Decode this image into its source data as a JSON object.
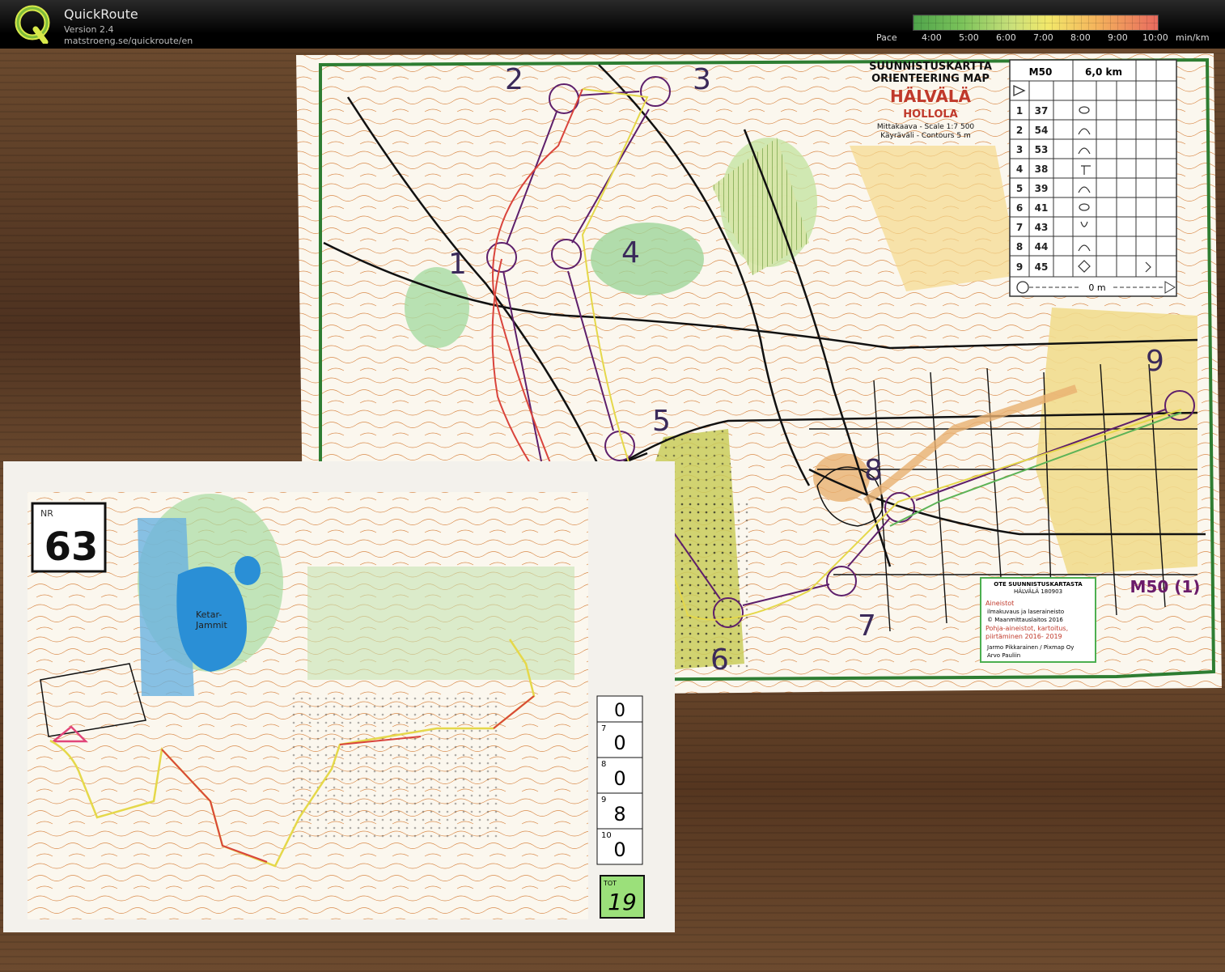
{
  "app": {
    "title": "QuickRoute",
    "version": "Version 2.4",
    "url": "matstroeng.se/quickroute/en",
    "logo_letter": "Q"
  },
  "pace_legend": {
    "label": "Pace",
    "ticks": [
      "4:00",
      "5:00",
      "6:00",
      "7:00",
      "8:00",
      "9:00",
      "10:00"
    ],
    "unit": "min/km"
  },
  "map": {
    "title_line1": "SUUNNISTUSKARTTA",
    "title_line2": "ORIENTEERING MAP",
    "area": "HÄLVÄLÄ",
    "municipality": "HOLLOLA",
    "scale": "Mittakaava - Scale 1:7 500",
    "contours": "Käyräväli - Contours 5 m",
    "course_label": "M50 (1)",
    "credits": {
      "header1": "OTE SUUNNISTUSKARTASTA",
      "header2": "HÄLVÄLÄ 180903",
      "aineistot": "Aineistot",
      "line1": "ilmakuvaus ja laseraineisto",
      "line2": "© Maanmittauslaitos 2016",
      "line3": "Pohja-aineistot, kartoitus,",
      "line4": "piirtäminen 2016- 2019",
      "line5": "Jarmo Pikkarainen / Pixmap Oy",
      "line6": "Arvo Pauliin"
    },
    "control_numbers": [
      "1",
      "2",
      "3",
      "4",
      "5",
      "6",
      "7",
      "8",
      "9"
    ]
  },
  "description_sheet": {
    "course": "M50",
    "length": "6,0 km",
    "rows": [
      {
        "n": "1",
        "code": "37"
      },
      {
        "n": "2",
        "code": "54"
      },
      {
        "n": "3",
        "code": "53"
      },
      {
        "n": "4",
        "code": "38"
      },
      {
        "n": "5",
        "code": "39"
      },
      {
        "n": "6",
        "code": "41"
      },
      {
        "n": "7",
        "code": "43"
      },
      {
        "n": "8",
        "code": "44"
      },
      {
        "n": "9",
        "code": "45"
      }
    ],
    "finish": "0 m"
  },
  "second_map": {
    "nr_label": "NR",
    "nr_value": "63",
    "lake_label_1": "Ketar-",
    "lake_label_2": "Jammit",
    "score_rows": [
      {
        "n": "7",
        "score": "0"
      },
      {
        "n": "8",
        "score": "0"
      },
      {
        "n": "9",
        "score": "8"
      },
      {
        "n": "10",
        "score": "0"
      }
    ],
    "tot_label": "TOT",
    "tot_value": "19"
  }
}
